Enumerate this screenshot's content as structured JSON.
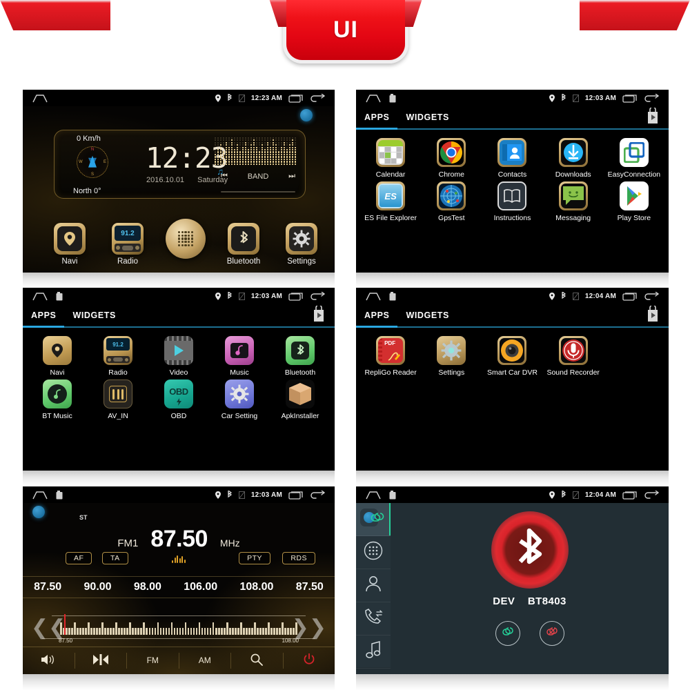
{
  "banner": {
    "title": "UI"
  },
  "panels": {
    "home": {
      "statusbar": {
        "time": "12:23 AM",
        "icons": [
          "home-icon",
          "location-icon",
          "bluetooth-icon",
          "sim-off-icon",
          "recents-icon",
          "back-icon"
        ]
      },
      "widget": {
        "speed": "0 Km/h",
        "heading": "North 0°",
        "clock": "12:23",
        "date": "2016.10.01",
        "weekday": "Saturday",
        "prev_label": "⏮",
        "band_label": "BAND",
        "next_label": "⏭"
      },
      "dock": [
        {
          "label": "Navi",
          "icon": "navi-pin-icon"
        },
        {
          "label": "Radio",
          "icon": "radio-icon",
          "display": "91.2"
        },
        {
          "label": "",
          "icon": "app-drawer-icon"
        },
        {
          "label": "Bluetooth",
          "icon": "bluetooth-icon"
        },
        {
          "label": "Settings",
          "icon": "gear-icon"
        }
      ]
    },
    "apps1": {
      "statusbar": {
        "time": "12:03 AM"
      },
      "tabs": [
        {
          "label": "APPS",
          "active": true
        },
        {
          "label": "WIDGETS",
          "active": false
        }
      ],
      "store_icon": "play-store-bag-icon",
      "apps": [
        {
          "label": "Calendar",
          "icon": "calendar-icon"
        },
        {
          "label": "Chrome",
          "icon": "chrome-icon"
        },
        {
          "label": "Contacts",
          "icon": "contacts-icon"
        },
        {
          "label": "Downloads",
          "icon": "downloads-icon"
        },
        {
          "label": "EasyConnection",
          "icon": "easyconnection-icon"
        },
        {
          "label": "ES File Explorer",
          "icon": "es-file-explorer-icon"
        },
        {
          "label": "GpsTest",
          "icon": "gpstest-icon"
        },
        {
          "label": "Instructions",
          "icon": "instructions-book-icon"
        },
        {
          "label": "Messaging",
          "icon": "messaging-icon"
        },
        {
          "label": "Play Store",
          "icon": "play-store-icon"
        }
      ]
    },
    "apps2": {
      "statusbar": {
        "time": "12:03 AM"
      },
      "tabs": [
        {
          "label": "APPS",
          "active": true
        },
        {
          "label": "WIDGETS",
          "active": false
        }
      ],
      "apps": [
        {
          "label": "Navi",
          "icon": "navi-pin-icon"
        },
        {
          "label": "Radio",
          "icon": "radio-icon",
          "display": "91.2"
        },
        {
          "label": "Video",
          "icon": "video-icon"
        },
        {
          "label": "Music",
          "icon": "music-icon"
        },
        {
          "label": "Bluetooth",
          "icon": "bluetooth-icon"
        },
        {
          "label": "BT Music",
          "icon": "bt-music-icon"
        },
        {
          "label": "AV_IN",
          "icon": "av-in-icon"
        },
        {
          "label": "OBD",
          "icon": "obd-icon",
          "display": "OBD"
        },
        {
          "label": "Car Setting",
          "icon": "car-setting-gear-icon"
        },
        {
          "label": "ApkInstaller",
          "icon": "apk-installer-box-icon"
        }
      ]
    },
    "apps3": {
      "statusbar": {
        "time": "12:04 AM"
      },
      "tabs": [
        {
          "label": "APPS",
          "active": true
        },
        {
          "label": "WIDGETS",
          "active": false
        }
      ],
      "apps": [
        {
          "label": "RepliGo Reader",
          "icon": "pdf-reader-icon",
          "display": "PDF"
        },
        {
          "label": "Settings",
          "icon": "gear-icon"
        },
        {
          "label": "Smart Car DVR",
          "icon": "dvr-camera-icon"
        },
        {
          "label": "Sound Recorder",
          "icon": "microphone-icon"
        }
      ]
    },
    "radio": {
      "statusbar": {
        "time": "12:03 AM"
      },
      "stereo_label": "ST",
      "band": "FM1",
      "frequency": "87.50",
      "unit": "MHz",
      "buttons": [
        {
          "label": "AF"
        },
        {
          "label": "TA"
        },
        {
          "label": "PTY"
        },
        {
          "label": "RDS"
        }
      ],
      "presets": [
        "87.50",
        "90.00",
        "98.00",
        "106.00",
        "108.00",
        "87.50"
      ],
      "tuner": {
        "min": "87.50",
        "max": "108.00"
      },
      "bottom_bar": [
        {
          "label": "",
          "icon": "volume-icon"
        },
        {
          "label": "",
          "icon": "balance-icon"
        },
        {
          "label": "FM",
          "icon": ""
        },
        {
          "label": "AM",
          "icon": ""
        },
        {
          "label": "",
          "icon": "search-icon"
        },
        {
          "label": "",
          "icon": "power-icon"
        }
      ]
    },
    "bluetooth": {
      "statusbar": {
        "time": "12:04 AM"
      },
      "sidebar": [
        {
          "icon": "link-connect-icon",
          "active": true
        },
        {
          "icon": "dialpad-icon",
          "active": false
        },
        {
          "icon": "contact-person-icon",
          "active": false
        },
        {
          "icon": "call-history-icon",
          "active": false
        },
        {
          "icon": "music-note-icon",
          "active": false
        }
      ],
      "device_prefix": "DEV",
      "device_name": "BT8403",
      "actions": [
        {
          "icon": "connect-link-icon",
          "color": "#25d39a"
        },
        {
          "icon": "disconnect-link-icon",
          "color": "#e0434a"
        }
      ]
    }
  },
  "colors": {
    "accent_blue": "#2aa7e0",
    "gold": "#c8a462",
    "red": "#e30613",
    "green": "#25d39a"
  }
}
